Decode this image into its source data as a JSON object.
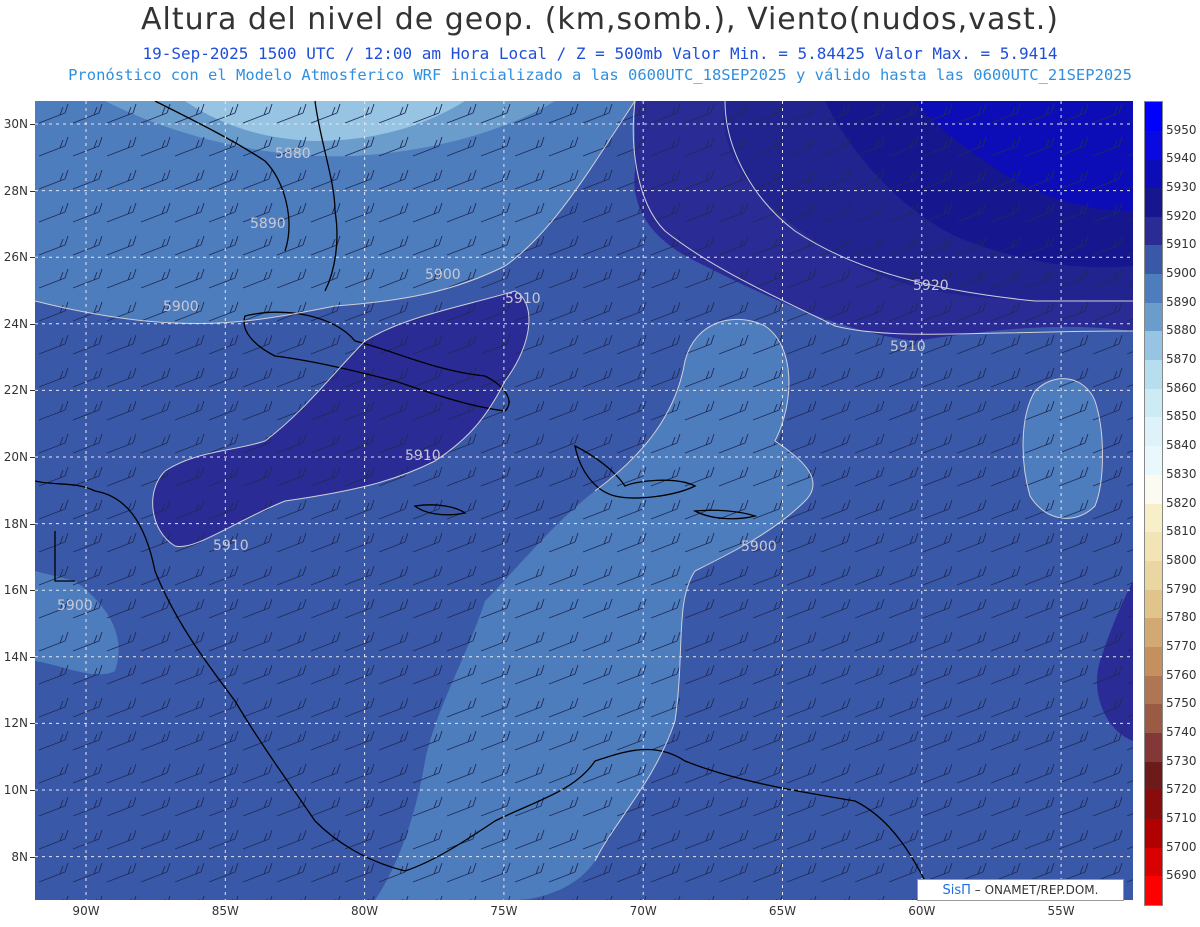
{
  "title": "Altura del nivel de geop. (km,somb.), Viento(nudos,vast.)",
  "subtitle": "19-Sep-2025  1500 UTC / 12:00 am Hora Local / Z = 500mb    Valor Min. = 5.84425  Valor Max. = 5.9414",
  "forecast_line": "Pronóstico con el Modelo Atmosferico WRF inicializado a las 0600UTC_18SEP2025 y válido hasta las  0600UTC_21SEP2025",
  "lat_labels": [
    "30N",
    "28N",
    "26N",
    "24N",
    "22N",
    "20N",
    "18N",
    "16N",
    "14N",
    "12N",
    "10N",
    "8N"
  ],
  "lon_labels": [
    "90W",
    "85W",
    "80W",
    "75W",
    "70W",
    "65W",
    "60W",
    "55W"
  ],
  "contour_labels": [
    "5880",
    "5890",
    "5900",
    "5900",
    "5910",
    "5920",
    "5910",
    "5900",
    "5910",
    "5910",
    "5900",
    "5900"
  ],
  "colorbar": {
    "levels": [
      "5950",
      "5940",
      "5930",
      "5920",
      "5910",
      "5900",
      "5890",
      "5880",
      "5870",
      "5860",
      "5850",
      "5840",
      "5830",
      "5820",
      "5810",
      "5800",
      "5790",
      "5780",
      "5770",
      "5760",
      "5750",
      "5740",
      "5730",
      "5720",
      "5710",
      "5700",
      "5690"
    ],
    "colors": [
      "#0000ff",
      "#0a0ae0",
      "#0d0db8",
      "#16168f",
      "#2b2b95",
      "#3a58a8",
      "#4e7dbe",
      "#6a9ccc",
      "#96c4e2",
      "#b6deee",
      "#cdebf5",
      "#ddf2f9",
      "#e8f8fb",
      "#fbfbf2",
      "#f7efc8",
      "#f2e4b4",
      "#ead6a1",
      "#e0c48b",
      "#d2a873",
      "#c4905e",
      "#b07552",
      "#9b5a44",
      "#843737",
      "#6c1a1a",
      "#8a0b0b",
      "#b00000",
      "#d80000",
      "#ff0000"
    ]
  },
  "credit": {
    "brand": "SisΠ",
    "text": " – ONAMET/REP.DOM."
  },
  "colors": {
    "z5930": "#16168f",
    "z5920": "#21238e",
    "z5910": "#2b2b95",
    "z5900": "#3a58a8",
    "z5890": "#4e7dbe",
    "z5880": "#6a9ccc",
    "z5870": "#96c4e2"
  }
}
